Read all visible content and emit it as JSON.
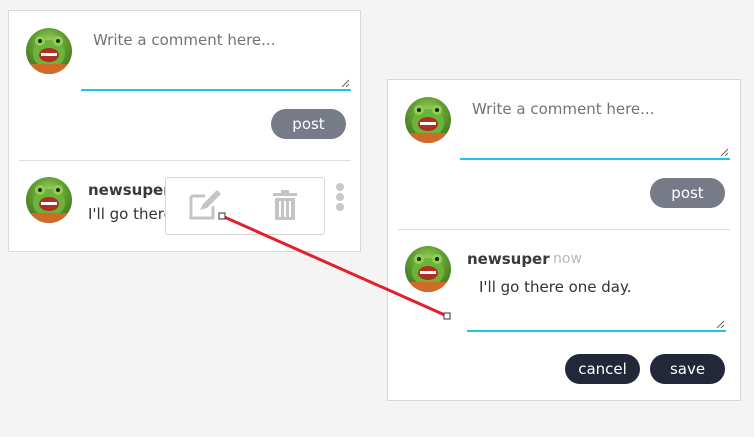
{
  "left_panel": {
    "comment_placeholder": "Write a comment here...",
    "post_label": "post",
    "comment": {
      "username": "newsuper",
      "text": "I'll go there one day."
    },
    "actions": {
      "edit_icon": "edit-icon",
      "delete_icon": "trash-icon",
      "more_icon": "kebab-menu-icon"
    }
  },
  "right_panel": {
    "comment_placeholder": "Write a comment here...",
    "post_label": "post",
    "comment": {
      "username": "newsuper",
      "timestamp": "now",
      "edit_value": "I'll go there one day."
    },
    "cancel_label": "cancel",
    "save_label": "save"
  },
  "colors": {
    "accent": "#22c3e6",
    "post_button": "#767b87",
    "dark_button": "#22273a",
    "connector": "#e0202a"
  }
}
